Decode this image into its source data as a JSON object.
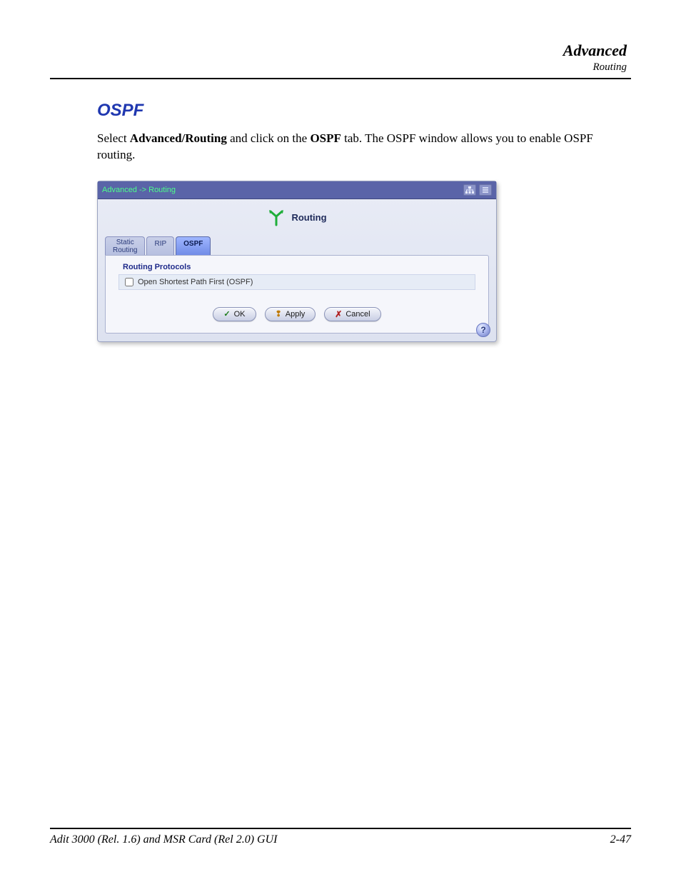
{
  "header": {
    "category": "Advanced",
    "subcategory": "Routing"
  },
  "section": {
    "heading": "OSPF",
    "paragraph_pre": "Select ",
    "paragraph_bold1": "Advanced/Routing",
    "paragraph_mid": " and click on the ",
    "paragraph_bold2": "OSPF",
    "paragraph_post": " tab.  The OSPF window allows you to enable OSPF routing."
  },
  "window": {
    "breadcrumb": "Advanced -> Routing",
    "title": "Routing",
    "tabs": {
      "static_line1": "Static",
      "static_line2": "Routing",
      "rip": "RIP",
      "ospf": "OSPF"
    },
    "protocols": {
      "heading": "Routing Protocols",
      "ospf_label": "Open Shortest Path First (OSPF)",
      "ospf_checked": false
    },
    "buttons": {
      "ok": "OK",
      "apply": "Apply",
      "cancel": "Cancel"
    },
    "help_label": "?"
  },
  "footer": {
    "left": "Adit 3000 (Rel. 1.6) and MSR Card (Rel 2.0) GUI",
    "right": "2-47"
  }
}
